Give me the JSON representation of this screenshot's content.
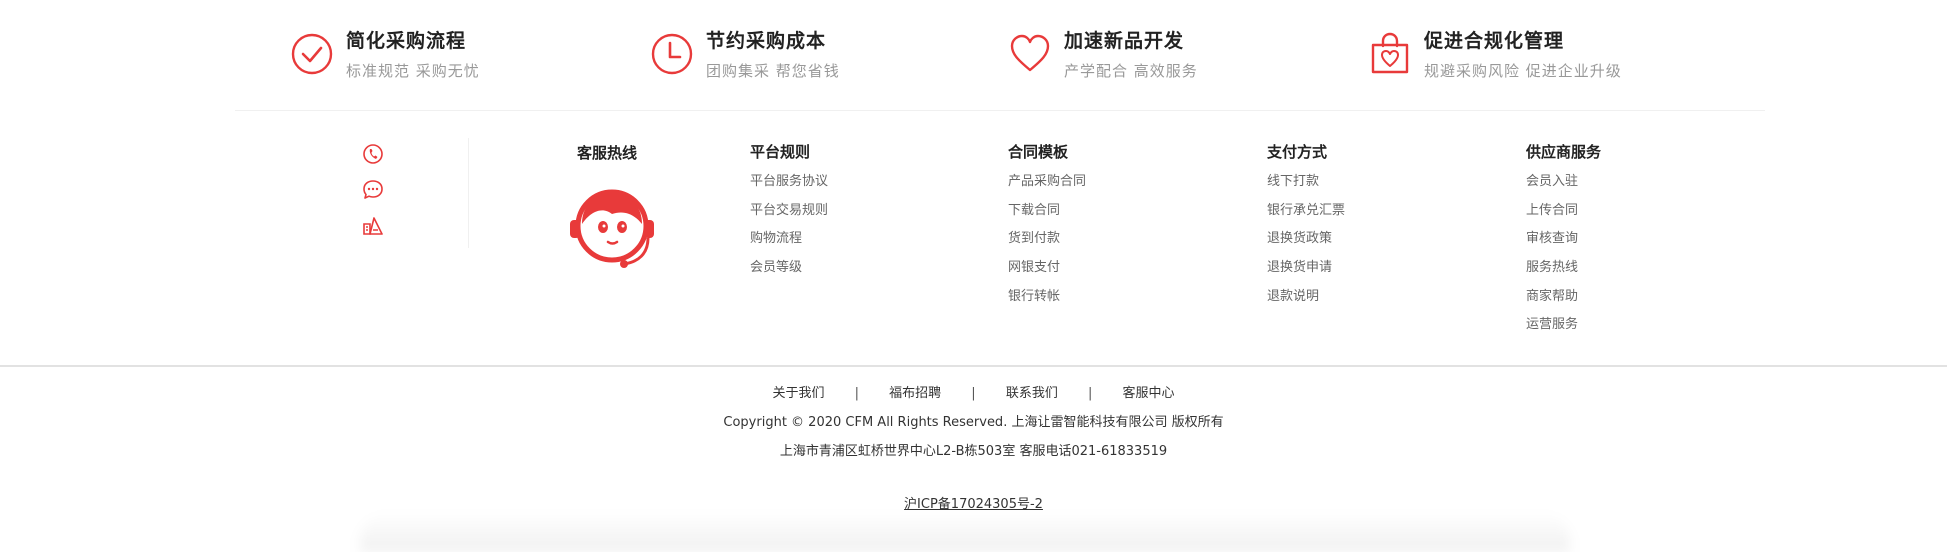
{
  "colors": {
    "accent": "#e83a3a",
    "title": "#222222",
    "subtitle": "#999999",
    "link": "#666666"
  },
  "features": [
    {
      "icon": "check-circle-icon",
      "title": "简化采购流程",
      "subtitle": "标准规范 采购无忧"
    },
    {
      "icon": "clock-icon",
      "title": "节约采购成本",
      "subtitle": "团购集采 帮您省钱"
    },
    {
      "icon": "heart-icon",
      "title": "加速新品开发",
      "subtitle": "产学配合 高效服务"
    },
    {
      "icon": "shopping-bag-heart-icon",
      "title": "促进合规化管理",
      "subtitle": "规避采购风险 促进企业升级"
    }
  ],
  "side_icons": [
    "phone-icon",
    "chat-bubble-icon",
    "feedback-icon"
  ],
  "hotline": {
    "title": "客服热线",
    "avatar_icon": "customer-service-avatar-icon"
  },
  "columns": [
    {
      "title": "平台规则",
      "links": [
        "平台服务协议",
        "平台交易规则",
        "购物流程",
        "会员等级"
      ]
    },
    {
      "title": "合同模板",
      "links": [
        "产品采购合同",
        "下载合同",
        "货到付款",
        "网银支付",
        "银行转帐"
      ]
    },
    {
      "title": "支付方式",
      "links": [
        "线下打款",
        "银行承兑汇票",
        "退换货政策",
        "退换货申请",
        "退款说明"
      ]
    },
    {
      "title": "供应商服务",
      "links": [
        "会员入驻",
        "上传合同",
        "审核查询",
        "服务热线",
        "商家帮助",
        "运营服务"
      ]
    }
  ],
  "bottom_links": [
    "关于我们",
    "福布招聘",
    "联系我们",
    "客服中心"
  ],
  "bottom_separator": "|",
  "copyright": "Copyright © 2020 CFM All Rights Reserved. 上海让雷智能科技有限公司 版权所有",
  "address": "上海市青浦区虹桥世界中心L2-B栋503室 客服电话021-61833519",
  "icp": "沪ICP备17024305号-2"
}
